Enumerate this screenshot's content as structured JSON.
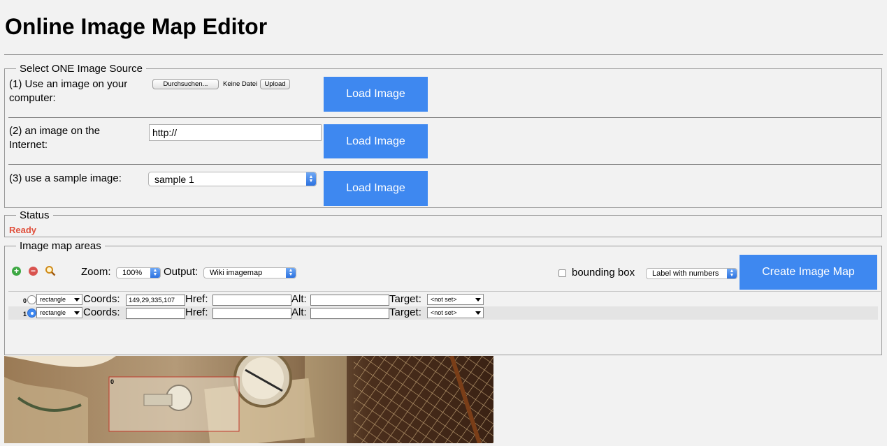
{
  "page": {
    "title": "Online Image Map Editor"
  },
  "source": {
    "legend": "Select ONE Image Source",
    "option1": {
      "label": "(1) Use an image on your computer:",
      "browse_label": "Durchsuchen...",
      "file_status": "Keine Datei",
      "upload_label": "Upload",
      "load_label": "Load Image"
    },
    "option2": {
      "label": "(2) an image on the Internet:",
      "url_value": "http://",
      "load_label": "Load Image"
    },
    "option3": {
      "label": "(3) use a sample image:",
      "selected": "sample 1",
      "load_label": "Load Image"
    }
  },
  "status": {
    "legend": "Status",
    "text": "Ready",
    "color": "#e0503c"
  },
  "areas": {
    "legend": "Image map areas",
    "toolbar": {
      "add_icon": "add-circle-icon",
      "remove_icon": "remove-circle-icon",
      "zoom_icon": "magnifier-icon",
      "zoom_label": "Zoom:",
      "zoom_value": "100%",
      "output_label": "Output:",
      "output_value": "Wiki imagemap",
      "bounding_label": "bounding box",
      "bounding_checked": false,
      "label_mode": "Label with numbers",
      "create_label": "Create Image Map"
    },
    "rows": [
      {
        "index": "0",
        "shape": "rectangle",
        "coords_label": "Coords:",
        "coords": "149,29,335,107",
        "href_label": "Href:",
        "href": "",
        "alt_label": "Alt:",
        "alt": "",
        "target_label": "Target:",
        "target": "<not set>",
        "selected": false
      },
      {
        "index": "1",
        "shape": "rectangle",
        "coords_label": "Coords:",
        "coords": "",
        "href_label": "Href:",
        "href": "",
        "alt_label": "Alt:",
        "alt": "",
        "target_label": "Target:",
        "target": "<not set>",
        "selected": true
      }
    ]
  },
  "canvas": {
    "area_label": "0",
    "accent": "#c0392b"
  }
}
